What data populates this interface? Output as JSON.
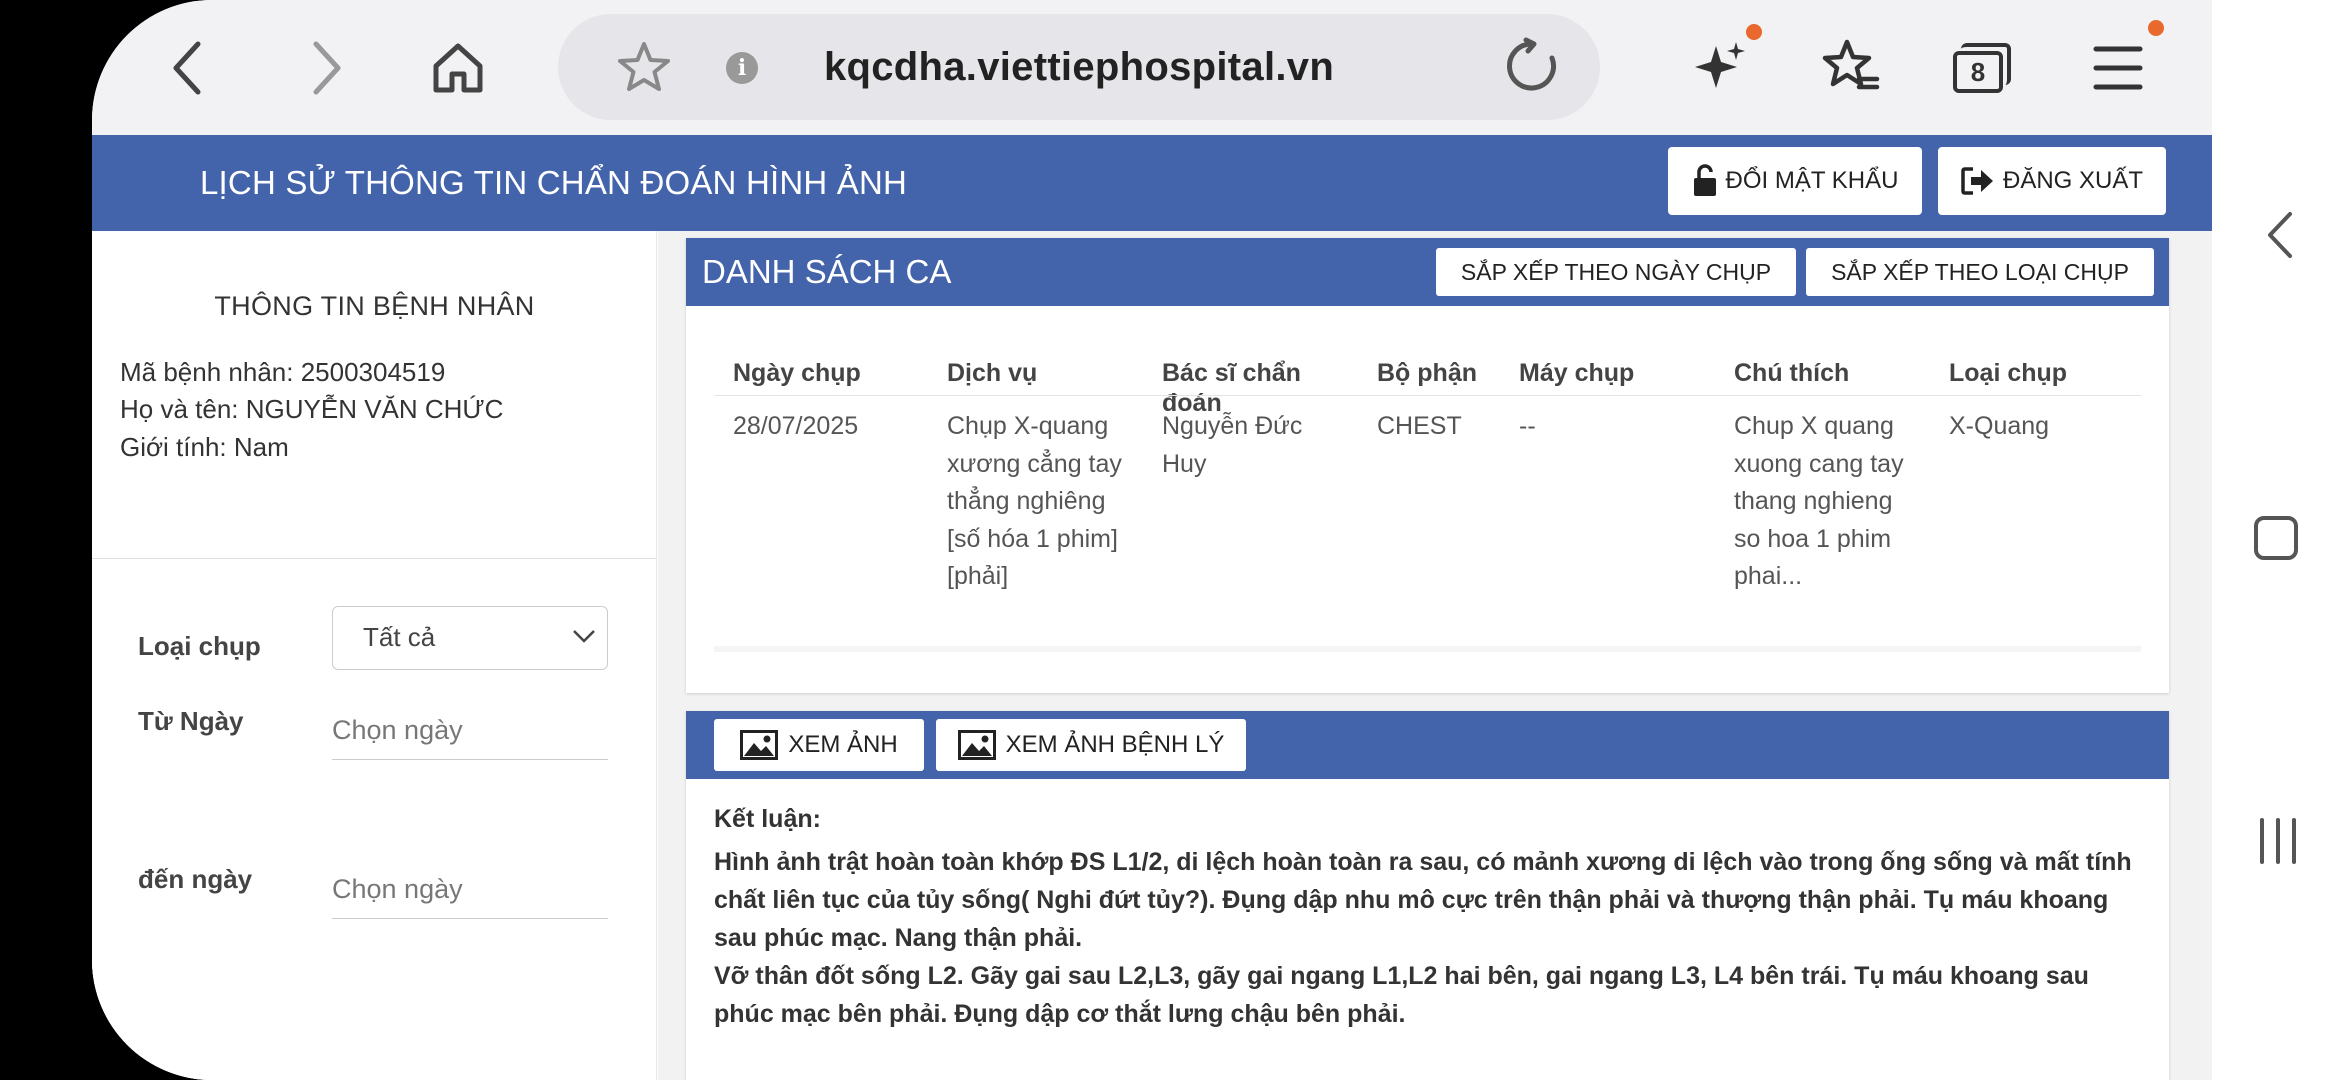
{
  "browser": {
    "url": "kqcdha.viettiephospital.vn",
    "tab_count": "8"
  },
  "header": {
    "title": "LỊCH SỬ THÔNG TIN CHẨN ĐOÁN HÌNH ẢNH",
    "change_password": "ĐỔI MẬT KHẨU",
    "logout": "ĐĂNG XUẤT"
  },
  "sidebar": {
    "title": "THÔNG TIN BỆNH NHÂN",
    "patient_id": "Mã bệnh nhân: 2500304519",
    "patient_name": "Họ và tên: NGUYỄN VĂN CHỨC",
    "gender": "Giới tính: Nam",
    "type_label": "Loại chụp",
    "type_value": "Tất cả",
    "from_label": "Từ Ngày",
    "from_placeholder": "Chọn ngày",
    "to_label": "đến ngày",
    "to_placeholder": "Chọn ngày"
  },
  "list": {
    "title": "DANH SÁCH CA",
    "sort_date": "SẮP XẾP THEO NGÀY CHỤP",
    "sort_type": "SẮP XẾP THEO LOẠI CHỤP",
    "columns": [
      "Ngày chụp",
      "Dịch vụ",
      "Bác sĩ chẩn đoán",
      "Bộ phận",
      "Máy chụp",
      "Chú thích",
      "Loại chụp"
    ],
    "row": {
      "date": "28/07/2025",
      "service": "Chụp X-quang xương cẳng tay thẳng nghiêng [số hóa 1 phim] [phải]",
      "doctor": "Nguyễn Đức Huy",
      "part": "CHEST",
      "machine": "--",
      "note": "Chup X quang xuong cang tay thang nghieng so hoa 1 phim phai...",
      "type": "X-Quang"
    }
  },
  "detail": {
    "view_image": "XEM ẢNH",
    "view_pathology": "XEM ẢNH BỆNH LÝ",
    "conclusion_label": "Kết luận:",
    "conclusion_1": "Hình ảnh trật hoàn toàn khớp ĐS L1/2, di lệch hoàn toàn ra sau, có mảnh xương di lệch vào trong ống sống và mất tính chất liên tục của tủy sống( Nghi đứt tủy?). Đụng dập nhu mô cực trên thận phải và thượng thận phải. Tụ máu khoang sau phúc mạc. Nang thận phải.",
    "conclusion_2": "Vỡ thân đốt sống L2. Gãy gai sau L2,L3, gãy gai ngang L1,L2 hai bên, gai ngang L3, L4 bên trái. Tụ máu khoang sau phúc mạc bên phải. Đụng dập cơ thắt lưng chậu bên phải."
  },
  "colors": {
    "brand_blue": "#4364ab",
    "notification_dot": "#e8682e"
  }
}
